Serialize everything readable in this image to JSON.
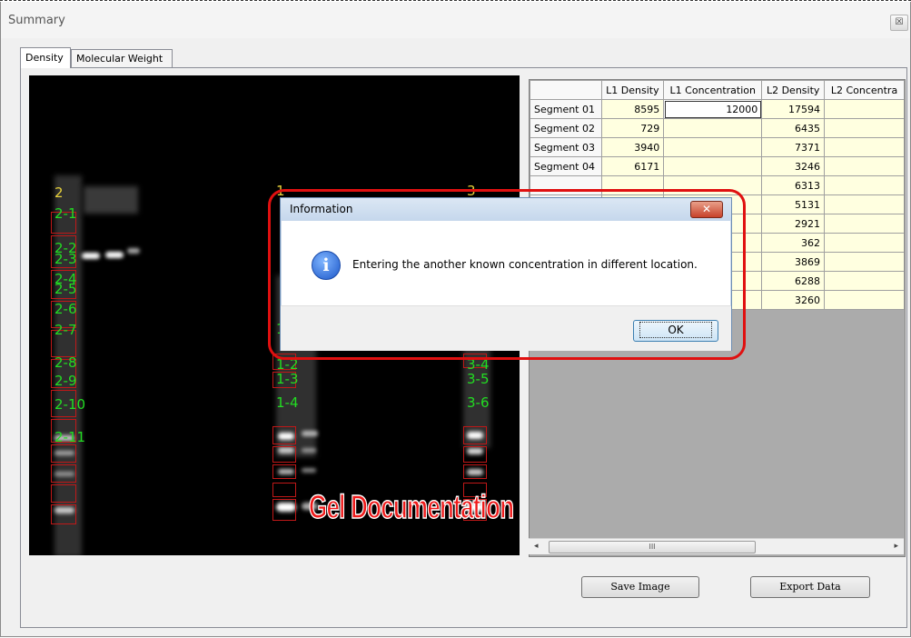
{
  "window": {
    "title": "Summary",
    "close_glyph": "☒"
  },
  "tabs": [
    {
      "label": "Density",
      "active": true
    },
    {
      "label": "Molecular Weight",
      "active": false
    }
  ],
  "gel": {
    "labels": {
      "l2_top": "2",
      "l2_1": "2-1",
      "l2_2": "2-2",
      "l2_3": "2-3",
      "l2_4": "2-4",
      "l2_5": "2-5",
      "l2_6": "2-6",
      "l2_7": "2-7",
      "l2_8": "2-8",
      "l2_9": "2-9",
      "l2_10": "2-10",
      "l2_11": "2-11",
      "l1_top": "1",
      "l1_mid": "1",
      "l1_2": "1-2",
      "l1_3": "1-3",
      "l1_4": "1-4",
      "l3_top": "3",
      "l3_4": "3-4",
      "l3_5": "3-5",
      "l3_6": "3-6"
    },
    "watermark": "Gel Documentation"
  },
  "grid": {
    "columns": [
      "L1 Density",
      "L1 Concentration",
      "L2 Density",
      "L2 Concentra"
    ],
    "rows": [
      {
        "name": "Segment 01",
        "l1_density": "8595",
        "l1_conc": "12000",
        "l2_density": "17594"
      },
      {
        "name": "Segment 02",
        "l1_density": "729",
        "l1_conc": "",
        "l2_density": "6435"
      },
      {
        "name": "Segment 03",
        "l1_density": "3940",
        "l1_conc": "",
        "l2_density": "7371"
      },
      {
        "name": "Segment 04",
        "l1_density": "6171",
        "l1_conc": "",
        "l2_density": "3246"
      },
      {
        "name": "",
        "l1_density": "",
        "l1_conc": "",
        "l2_density": "6313"
      },
      {
        "name": "",
        "l1_density": "",
        "l1_conc": "",
        "l2_density": "5131"
      },
      {
        "name": "",
        "l1_density": "",
        "l1_conc": "",
        "l2_density": "2921"
      },
      {
        "name": "",
        "l1_density": "",
        "l1_conc": "",
        "l2_density": "362"
      },
      {
        "name": "",
        "l1_density": "",
        "l1_conc": "",
        "l2_density": "3869"
      },
      {
        "name": "",
        "l1_density": "",
        "l1_conc": "",
        "l2_density": "6288"
      },
      {
        "name": "",
        "l1_density": "",
        "l1_conc": "",
        "l2_density": "3260"
      }
    ],
    "scroll_thumb": "III",
    "scroll_left": "◂",
    "scroll_right": "▸"
  },
  "buttons": {
    "save_image": "Save Image",
    "export_data": "Export Data"
  },
  "dialog": {
    "title": "Information",
    "close_glyph": "✕",
    "icon_glyph": "i",
    "message": "Entering the another known concentration in different location.",
    "ok": "OK"
  }
}
